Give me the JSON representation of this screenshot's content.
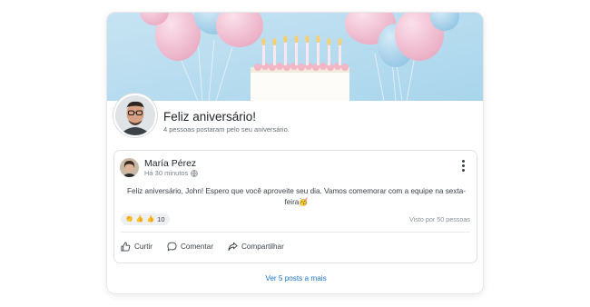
{
  "header": {
    "title": "Feliz aniversário!",
    "subtitle": "4 pessoas postaram pelo seu aniversário."
  },
  "post": {
    "author": "María Pérez",
    "time": "Há 30 minutos",
    "text": "Feliz aniversário, John! Espero que você aproveite seu dia. Vamos comemorar com a equipe na sexta-feira🥳",
    "reaction_count": "10",
    "reaction_icons": [
      "clapping-hands-icon",
      "thumbs-up-icon",
      "thumbs-up-icon"
    ],
    "seen_by": "Visto por 50 pessoas",
    "actions": {
      "like": "Curtir",
      "comment": "Comentar",
      "share": "Compartilhar"
    }
  },
  "footer": {
    "more_posts": "Ver 5 posts a mais"
  },
  "colors": {
    "link": "#1a73c9",
    "banner_bg": "#b7dcef"
  }
}
